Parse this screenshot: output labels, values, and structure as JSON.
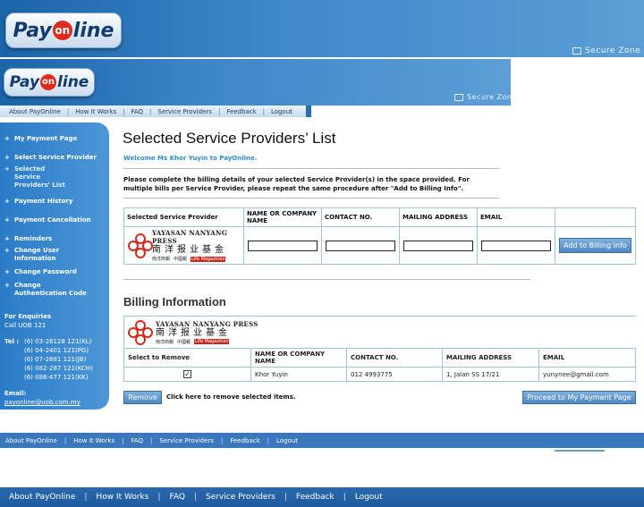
{
  "brand": {
    "logo_main": "Pay",
    "logo_on": "on",
    "logo_tail": "line"
  },
  "secure_zone": "Secure Zone",
  "nav": {
    "items": [
      "About PayOnline",
      "How It Works",
      "FAQ",
      "Service Providers",
      "Feedback",
      "Logout"
    ],
    "separator": "|"
  },
  "sidebar": {
    "items": [
      {
        "label": "My Payment Page",
        "active": false
      },
      {
        "label": "Select Service Provider",
        "active": false
      },
      {
        "label": "Selected Service Providers' List",
        "active": true
      },
      {
        "label": "Payment History",
        "active": false
      },
      {
        "label": "Payment Cancellation",
        "active": false
      },
      {
        "label": "Reminders",
        "active": false
      },
      {
        "label": "Change User Information",
        "active": false
      },
      {
        "label": "Change Password",
        "active": false
      },
      {
        "label": "Change Authentication Code",
        "active": false
      }
    ],
    "enquiries_label": "For Enquiries",
    "enquiries_sub": "Call UOB 121",
    "tel_label": "Tel",
    "tel_lines": [
      "(6) 03-26128 121(KL)",
      "(6) 04-2401 121(PG)",
      "(6) 07-2881 121(JB)",
      "(6) 082-287 121(KCH)",
      "(6) 088-477 121(KK)"
    ],
    "email_label": "Email:",
    "email": "payonline@uob.com.my"
  },
  "main": {
    "title": "Selected Service Providers’ List",
    "welcome": "Welcome Ms Khor Yuyin to PayOnline.",
    "instruction": "Please complete the billing details of your selected Service Provider(s) in the space provided. For multiple bills per Service Provider, please repeat the same procedure after \"Add to Billing Info\".",
    "provider_table": {
      "headers": [
        "Selected Service Provider",
        "NAME OR COMPANY NAME",
        "CONTACT NO.",
        "MAILING ADDRESS",
        "EMAIL"
      ],
      "add_button": "Add to Billing Info"
    },
    "provider_logo": {
      "english": "YAYASAN NANYANG PRESS",
      "chinese": "南洋报业基金",
      "sub1": "南洋商報",
      "sub2": "中國報",
      "sub3": "Life Magazines"
    },
    "billing_title": "Billing Information",
    "billing_table": {
      "headers": [
        "Select to Remove",
        "NAME OR COMPANY NAME",
        "CONTACT NO.",
        "MAILING ADDRESS",
        "EMAIL"
      ],
      "row": {
        "checked": true,
        "name": "Khor Yuyin",
        "contact": "012 4993775",
        "address": "1, Jalan SS 17/21",
        "email": "yunynee@gmail.com"
      }
    },
    "remove_button": "Remove",
    "remove_text": "Click here to remove selected items.",
    "proceed_button": "Proceed to My Payment Page"
  }
}
